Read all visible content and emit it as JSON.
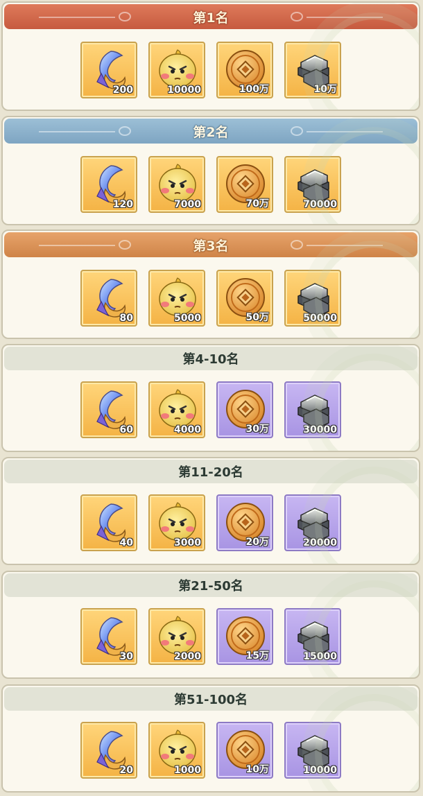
{
  "ranks": [
    {
      "label": "第1名",
      "style": "red",
      "items": [
        {
          "icon": "crystal-feather-icon",
          "qty": "200",
          "bg": "gold"
        },
        {
          "icon": "yellow-chick-icon",
          "qty": "10000",
          "bg": "gold"
        },
        {
          "icon": "copper-coin-icon",
          "qty": "100万",
          "bg": "gold"
        },
        {
          "icon": "iron-ingot-icon",
          "qty": "10万",
          "bg": "gold"
        }
      ]
    },
    {
      "label": "第2名",
      "style": "blue",
      "items": [
        {
          "icon": "crystal-feather-icon",
          "qty": "120",
          "bg": "gold"
        },
        {
          "icon": "yellow-chick-icon",
          "qty": "7000",
          "bg": "gold"
        },
        {
          "icon": "copper-coin-icon",
          "qty": "70万",
          "bg": "gold"
        },
        {
          "icon": "iron-ingot-icon",
          "qty": "70000",
          "bg": "gold"
        }
      ]
    },
    {
      "label": "第3名",
      "style": "orange",
      "items": [
        {
          "icon": "crystal-feather-icon",
          "qty": "80",
          "bg": "gold"
        },
        {
          "icon": "yellow-chick-icon",
          "qty": "5000",
          "bg": "gold"
        },
        {
          "icon": "copper-coin-icon",
          "qty": "50万",
          "bg": "gold"
        },
        {
          "icon": "iron-ingot-icon",
          "qty": "50000",
          "bg": "gold"
        }
      ]
    },
    {
      "label": "第4-10名",
      "style": "plain",
      "items": [
        {
          "icon": "crystal-feather-icon",
          "qty": "60",
          "bg": "gold"
        },
        {
          "icon": "yellow-chick-icon",
          "qty": "4000",
          "bg": "gold"
        },
        {
          "icon": "copper-coin-icon",
          "qty": "30万",
          "bg": "purple"
        },
        {
          "icon": "iron-ingot-icon",
          "qty": "30000",
          "bg": "purple"
        }
      ]
    },
    {
      "label": "第11-20名",
      "style": "plain",
      "items": [
        {
          "icon": "crystal-feather-icon",
          "qty": "40",
          "bg": "gold"
        },
        {
          "icon": "yellow-chick-icon",
          "qty": "3000",
          "bg": "gold"
        },
        {
          "icon": "copper-coin-icon",
          "qty": "20万",
          "bg": "purple"
        },
        {
          "icon": "iron-ingot-icon",
          "qty": "20000",
          "bg": "purple"
        }
      ]
    },
    {
      "label": "第21-50名",
      "style": "plain",
      "items": [
        {
          "icon": "crystal-feather-icon",
          "qty": "30",
          "bg": "gold"
        },
        {
          "icon": "yellow-chick-icon",
          "qty": "2000",
          "bg": "gold"
        },
        {
          "icon": "copper-coin-icon",
          "qty": "15万",
          "bg": "purple"
        },
        {
          "icon": "iron-ingot-icon",
          "qty": "15000",
          "bg": "purple"
        }
      ]
    },
    {
      "label": "第51-100名",
      "style": "plain",
      "items": [
        {
          "icon": "crystal-feather-icon",
          "qty": "20",
          "bg": "gold"
        },
        {
          "icon": "yellow-chick-icon",
          "qty": "1000",
          "bg": "gold"
        },
        {
          "icon": "copper-coin-icon",
          "qty": "10万",
          "bg": "purple"
        },
        {
          "icon": "iron-ingot-icon",
          "qty": "10000",
          "bg": "purple"
        }
      ]
    }
  ]
}
